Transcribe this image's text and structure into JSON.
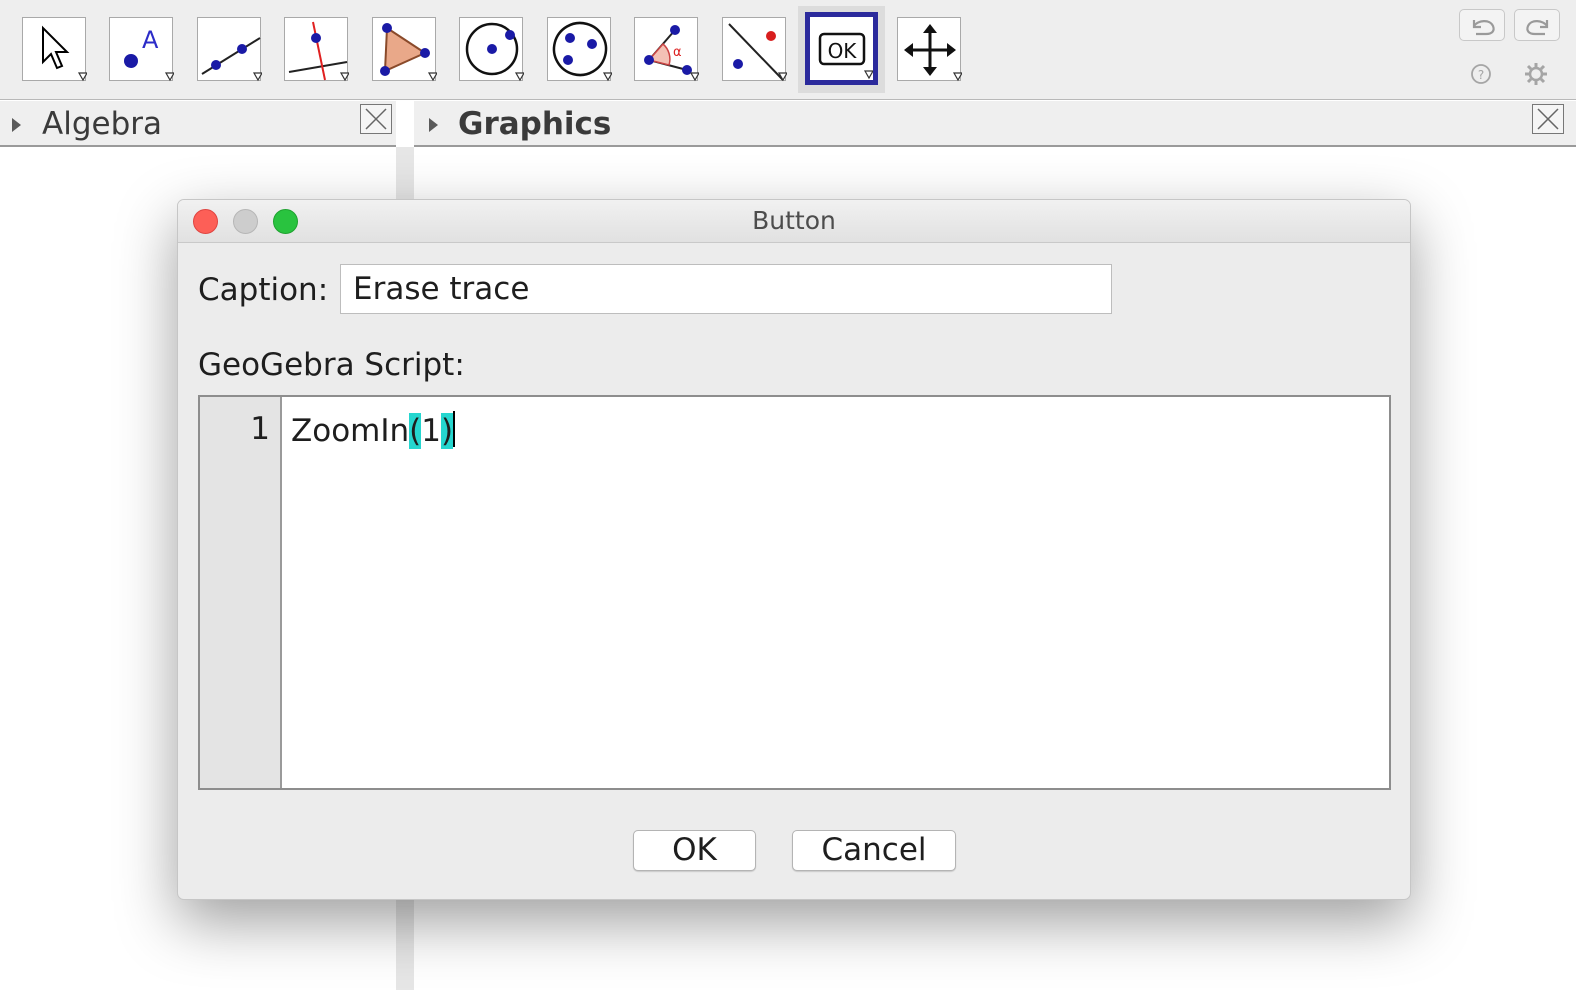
{
  "toolbar": {
    "tools": [
      {
        "name": "Move",
        "icon": "move-pointer-icon"
      },
      {
        "name": "Point",
        "icon": "point-icon"
      },
      {
        "name": "Line",
        "icon": "line-icon"
      },
      {
        "name": "Perpendicular Line",
        "icon": "perpendicular-line-icon"
      },
      {
        "name": "Polygon",
        "icon": "polygon-icon"
      },
      {
        "name": "Circle with Center",
        "icon": "circle-center-icon"
      },
      {
        "name": "Ellipse",
        "icon": "ellipse-icon"
      },
      {
        "name": "Angle",
        "icon": "angle-icon"
      },
      {
        "name": "Reflect about Line",
        "icon": "reflect-icon"
      },
      {
        "name": "Button",
        "icon": "button-tool-icon",
        "label": "OK",
        "selected": true
      },
      {
        "name": "Move Graphics View",
        "icon": "move-graphics-icon"
      }
    ],
    "undo_icon": "undo-icon",
    "redo_icon": "redo-icon",
    "help_icon": "help-icon",
    "settings_icon": "gear-icon"
  },
  "views": {
    "algebra_title": "Algebra",
    "graphics_title": "Graphics"
  },
  "dialog": {
    "title": "Button",
    "caption_label": "Caption:",
    "caption_value": "Erase trace",
    "script_label": "GeoGebra Script:",
    "line_number": "1",
    "code_prefix": "ZoomIn",
    "code_open_paren": "(",
    "code_arg": "1",
    "code_close_paren": ")",
    "ok_label": "OK",
    "cancel_label": "Cancel"
  },
  "colors": {
    "selected_tool_border": "#2b2a9c",
    "bracket_highlight": "#25d6cf",
    "close_light": "#fd5f57",
    "minimize_light": "#cdcdcd",
    "zoom_light": "#29c33f"
  }
}
